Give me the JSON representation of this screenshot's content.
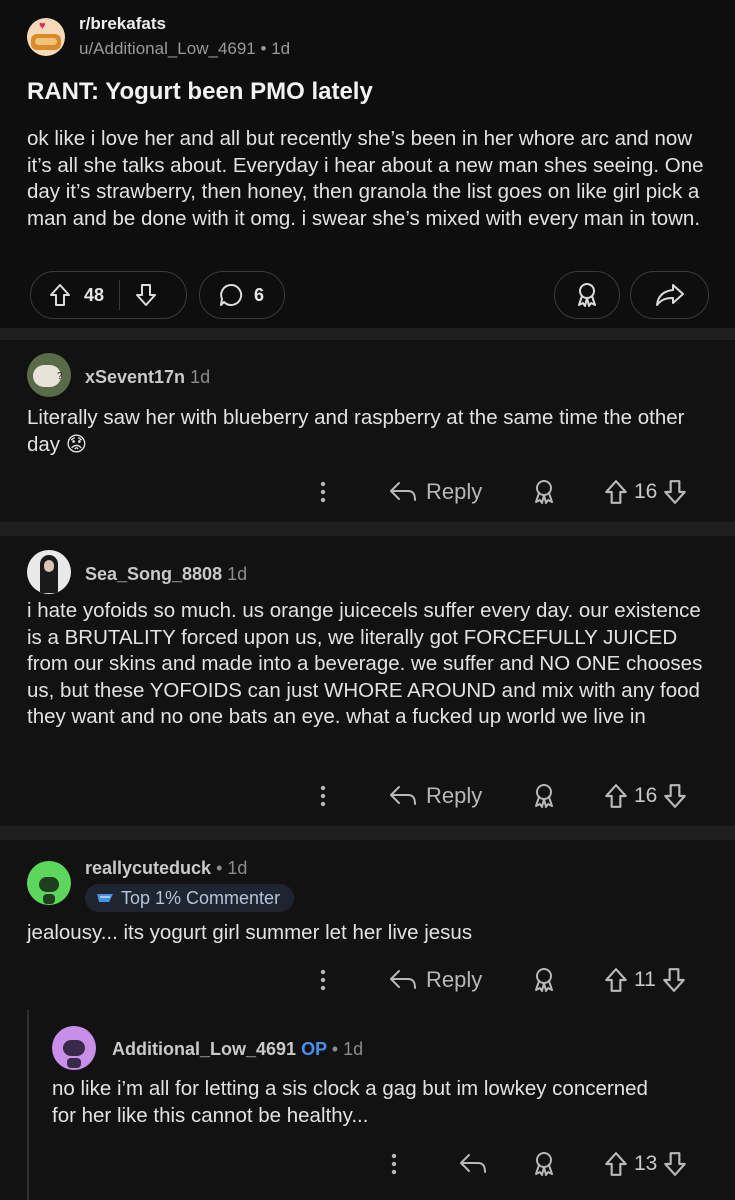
{
  "post": {
    "subreddit": "r/brekafats",
    "author": "u/Additional_Low_4691",
    "separator": "•",
    "age": "1d",
    "title": "RANT: Yogurt been PMO lately",
    "body": "ok like i love her and all but recently she’s been in her whore arc and now it’s all she talks about. Everyday i hear about a new man shes seeing. One day it’s strawberry, then honey, then granola the list goes on like girl pick a man and be done with it omg. i swear she’s mixed with every man in town.",
    "upvotes": "48",
    "comments": "6"
  },
  "comments": [
    {
      "user": "xSevent17n",
      "age": "1d",
      "body": "Literally saw her with blueberry and raspberry at the same time the other day 😟",
      "reply_label": "Reply",
      "score": "16"
    },
    {
      "user": "Sea_Song_8808",
      "age": "1d",
      "body": "i hate yofoids so much. us orange juicecels suffer every day. our existence is a BRUTALITY forced upon us, we literally got FORCEFULLY JUICED from our skins and made into a beverage. we suffer and NO ONE chooses us, but these YOFOIDS can just WHORE AROUND and mix with any food they want and no one bats an eye. what a fucked up world we live in",
      "reply_label": "Reply",
      "score": "16"
    },
    {
      "user": "reallycuteduck",
      "separator": "•",
      "age": "1d",
      "badge": "Top 1% Commenter",
      "body": "jealousy... its yogurt girl summer let her live jesus",
      "reply_label": "Reply",
      "score": "11"
    },
    {
      "user": "Additional_Low_4691",
      "op_label": "OP",
      "separator": "•",
      "age": "1d",
      "body": "no like i’m all for letting a sis clock a gag but im lowkey concerned for her like this cannot be healthy...",
      "score": "13"
    }
  ],
  "icons": {
    "upvote": "arrow-up-icon",
    "downvote": "arrow-down-icon",
    "comment": "comment-bubble-icon",
    "award": "award-icon",
    "share": "share-icon",
    "more": "more-vertical-icon",
    "reply": "reply-arrow-icon"
  },
  "colors": {
    "background": "#0e0e0e",
    "comment_background": "#121212",
    "op_blue": "#4a8ff0",
    "badge_bg": "#1e2530"
  }
}
